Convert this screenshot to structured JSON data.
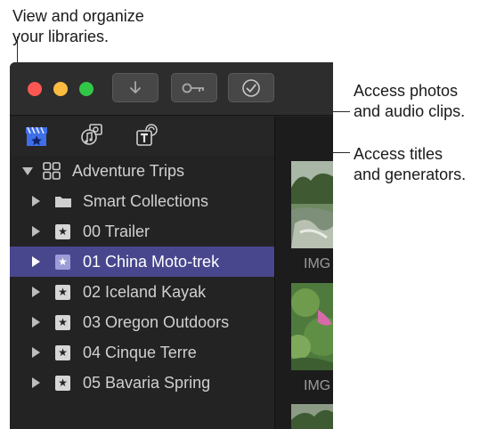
{
  "callouts": {
    "libraries": [
      "View and organize",
      "your libraries."
    ],
    "photos_audio": [
      "Access photos",
      "and audio clips."
    ],
    "titles_generators": [
      "Access titles",
      "and generators."
    ]
  },
  "window": {
    "traffic_lights": {
      "close": "#fc5753",
      "minimize": "#fdbc40",
      "maximize": "#33c748"
    },
    "toolbar_buttons": [
      "download-icon",
      "key-icon",
      "checkmark-circle-icon"
    ]
  },
  "browser_tabs": [
    "libraries-icon",
    "photos-audio-icon",
    "titles-generators-icon"
  ],
  "library": {
    "name": "Adventure Trips",
    "items": [
      {
        "label": "Smart Collections",
        "icon": "folder-icon",
        "selected": false
      },
      {
        "label": "00 Trailer",
        "icon": "star-icon",
        "selected": false
      },
      {
        "label": "01 China Moto-trek",
        "icon": "star-icon",
        "selected": true
      },
      {
        "label": "02 Iceland Kayak",
        "icon": "star-icon",
        "selected": false
      },
      {
        "label": "03 Oregon Outdoors",
        "icon": "star-icon",
        "selected": false
      },
      {
        "label": "04 Cinque Terre",
        "icon": "star-icon",
        "selected": false
      },
      {
        "label": "05 Bavaria Spring",
        "icon": "star-icon",
        "selected": false
      }
    ]
  },
  "browser_clips": [
    {
      "caption": "IMG"
    },
    {
      "caption": "IMG"
    }
  ],
  "colors": {
    "selection": "#48478e",
    "sidebar_bg": "#232323",
    "accent": "#2e6ff2"
  }
}
